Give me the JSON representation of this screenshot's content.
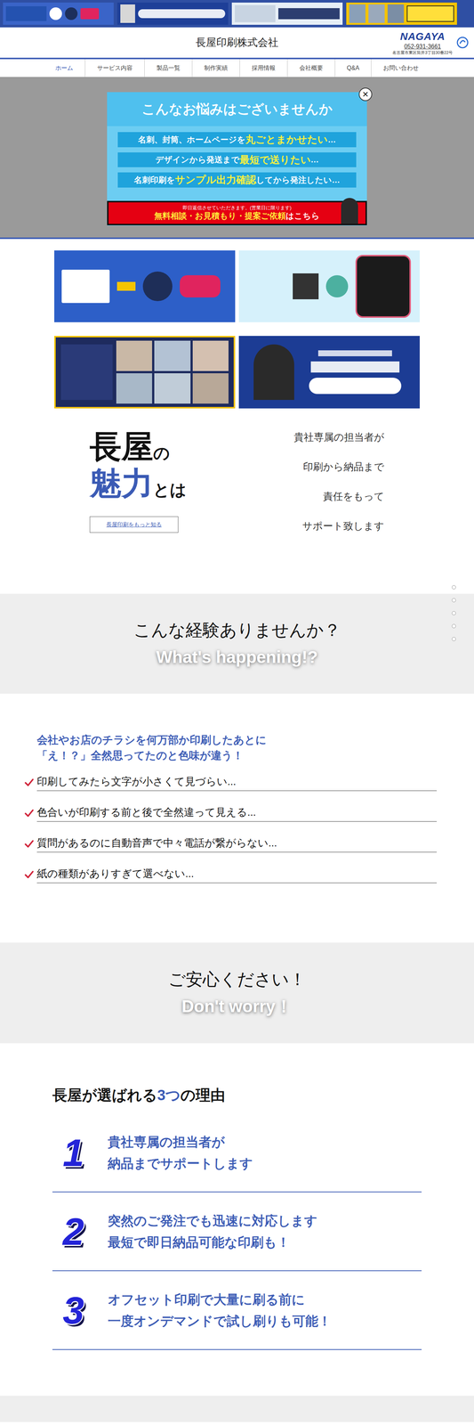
{
  "header": {
    "title": "長屋印刷株式会社",
    "logo": "NAGAYA",
    "phone": "052-931-3661",
    "address": "名古屋市東区筒井3丁目30番22号"
  },
  "nav": [
    {
      "label": "ホーム",
      "selected": true
    },
    {
      "label": "サービス内容",
      "selected": false
    },
    {
      "label": "製品一覧",
      "selected": false
    },
    {
      "label": "制作実績",
      "selected": false
    },
    {
      "label": "採用情報",
      "selected": false
    },
    {
      "label": "会社概要",
      "selected": false
    },
    {
      "label": "Q&A",
      "selected": false
    },
    {
      "label": "お問い合わせ",
      "selected": false
    }
  ],
  "popup": {
    "close": "×",
    "title": "こんなお悩みはございませんか",
    "rows": [
      {
        "parts": [
          {
            "text": "名刺、封筒、ホームページを",
            "highlight": false
          },
          {
            "text": "丸ごとまかせたい",
            "highlight": true
          },
          {
            "text": "…",
            "highlight": false
          }
        ]
      },
      {
        "parts": [
          {
            "text": "デザインから発送まで",
            "highlight": false
          },
          {
            "text": "最短で送りたい",
            "highlight": true
          },
          {
            "text": "…",
            "highlight": false
          }
        ]
      },
      {
        "parts": [
          {
            "text": "名刺印刷を",
            "highlight": false
          },
          {
            "text": "サンプル出力確認",
            "highlight": true
          },
          {
            "text": "してから発注したい…",
            "highlight": false
          }
        ]
      }
    ],
    "cta_note": "即日返信させていただきます。(営業日に限ります)",
    "cta_parts": [
      {
        "text": "無料相談・お見積もり・提案ご依頼",
        "highlight": true
      },
      {
        "text": "はこちら",
        "highlight": false
      }
    ]
  },
  "appeal": {
    "title_lines": [
      [
        {
          "text": "長屋",
          "kind": "big"
        },
        {
          "text": "の",
          "kind": "small"
        }
      ],
      [
        {
          "text": "魅力",
          "kind": "accent"
        },
        {
          "text": "とは",
          "kind": "small"
        }
      ]
    ],
    "button": "長屋印刷をもっと知る",
    "lines": [
      "貴社専属の担当者が",
      "印刷から納品まで",
      "責任をもって",
      "サポート致します"
    ]
  },
  "side_dots": [
    {
      "selected": false
    },
    {
      "selected": false
    },
    {
      "selected": false
    },
    {
      "selected": false
    },
    {
      "selected": false
    }
  ],
  "band1": {
    "title": "こんな経験ありませんか？",
    "subtitle": "What's happening!?"
  },
  "experience": {
    "lead": [
      "会社やお店のチラシを何万部か印刷したあとに",
      "「え！？」全然思ってたのと色味が違う！"
    ],
    "items": [
      "印刷してみたら文字が小さくて見づらい...",
      "色合いが印刷する前と後で全然違って見える...",
      "質問があるのに自動音声で中々電話が繋がらない...",
      "紙の種類がありすぎて選べない..."
    ]
  },
  "band2": {
    "title": "ご安心ください！",
    "subtitle": "Don't worry！"
  },
  "reasons": {
    "title_parts": [
      {
        "text": "長屋が選ばれる",
        "highlight": false
      },
      {
        "text": "3つ",
        "highlight": true
      },
      {
        "text": "の理由",
        "highlight": false
      }
    ],
    "items": [
      {
        "number": "1",
        "lines": [
          "貴社専属の担当者が",
          "納品までサポートします"
        ]
      },
      {
        "number": "2",
        "lines": [
          "突然のご発注でも迅速に対応します",
          "最短で即日納品可能な印刷も！"
        ]
      },
      {
        "number": "3",
        "lines": [
          "オフセット印刷で大量に刷る前に",
          "一度オンデマンドで試し刷りも可能！"
        ]
      }
    ]
  }
}
